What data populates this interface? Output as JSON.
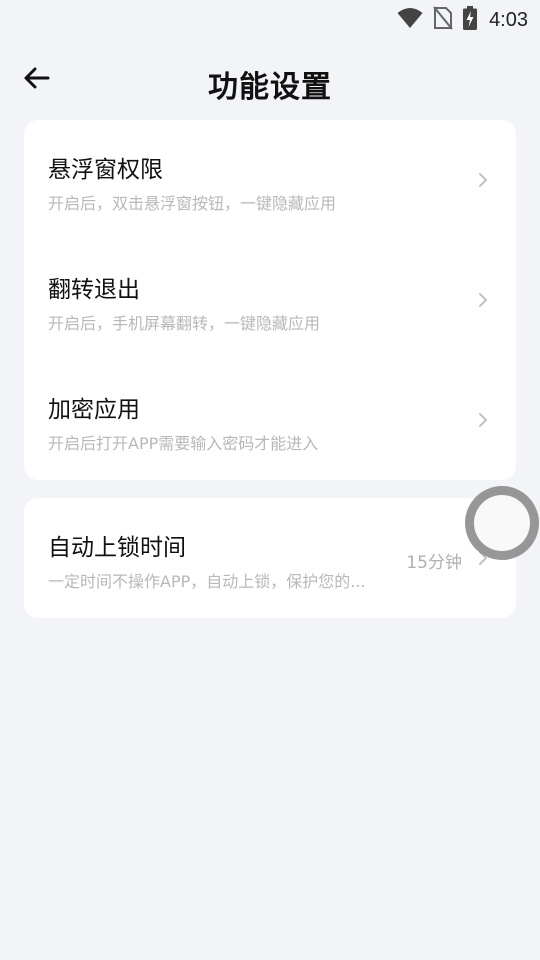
{
  "status_bar": {
    "time": "4:03",
    "icons": [
      "wifi-icon",
      "no-sim-icon",
      "battery-charging-icon"
    ]
  },
  "header": {
    "back_icon": "arrow-left-icon",
    "title": "功能设置"
  },
  "settings_group_1": {
    "items": [
      {
        "title": "悬浮窗权限",
        "subtitle": "开启后，双击悬浮窗按钮，一键隐藏应用",
        "icon": "chevron-right-icon"
      },
      {
        "title": "翻转退出",
        "subtitle": "开启后，手机屏幕翻转，一键隐藏应用",
        "icon": "chevron-right-icon"
      },
      {
        "title": "加密应用",
        "subtitle": "开启后打开APP需要输入密码才能进入",
        "icon": "chevron-right-icon"
      }
    ]
  },
  "settings_group_2": {
    "items": [
      {
        "title": "自动上锁时间",
        "subtitle": "一定时间不操作APP，自动上锁，保护您的...",
        "value": "15分钟",
        "icon": "chevron-right-icon"
      }
    ]
  },
  "floating_button": {
    "icon": "floating-ball-icon"
  },
  "colors": {
    "background": "#f3f4f7",
    "card": "#ffffff",
    "title_text": "#111111",
    "subtitle_text": "#b8b8b8",
    "chevron": "#c4c4c4"
  }
}
